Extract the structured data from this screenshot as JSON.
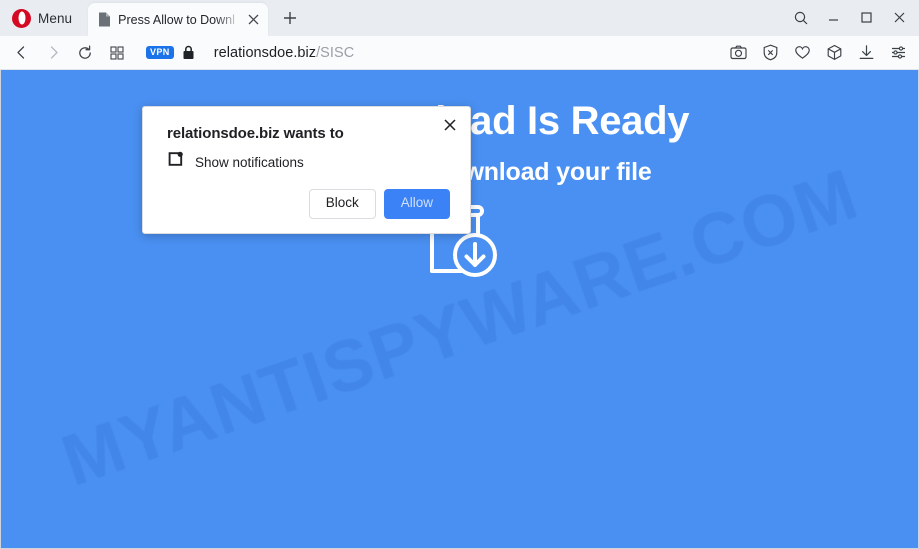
{
  "window": {
    "menu_label": "Menu",
    "opera_logo": "opera-logo",
    "controls": {
      "search": "search-icon",
      "minimize": "minimize-icon",
      "maximize": "maximize-icon",
      "close": "close-icon"
    }
  },
  "tabs": [
    {
      "title": "Press Allow to Downl",
      "favicon": "page-icon",
      "close": "×",
      "active": true
    }
  ],
  "new_tab_label": "+",
  "navbar": {
    "back": "back-arrow-icon",
    "forward": "forward-arrow-icon",
    "reload": "reload-icon",
    "tab_grid": "tab-grid-icon",
    "vpn_badge": "VPN",
    "lock": "lock-icon",
    "url_host": "relationsdoe.biz",
    "url_path": "/SISC",
    "toolbar_icons": [
      "snapshot-camera-icon",
      "ad-blocker-shield-icon",
      "heart-icon",
      "crypto-wallet-cube-icon",
      "downloads-icon",
      "easy-setup-sliders-icon"
    ]
  },
  "page": {
    "background_color": "#4a90f2",
    "watermark": "MYANTISPYWARE.COM",
    "heading": "Your Download Is Ready",
    "subheading": "Click Allow to download your file",
    "download_icon": "book-download-icon"
  },
  "permission_dialog": {
    "title": "relationsdoe.biz wants to",
    "permission_icon": "notifications-icon",
    "permission_label": "Show notifications",
    "block_label": "Block",
    "allow_label": "Allow",
    "close_label": "×",
    "allow_color": "#3b82f6"
  }
}
